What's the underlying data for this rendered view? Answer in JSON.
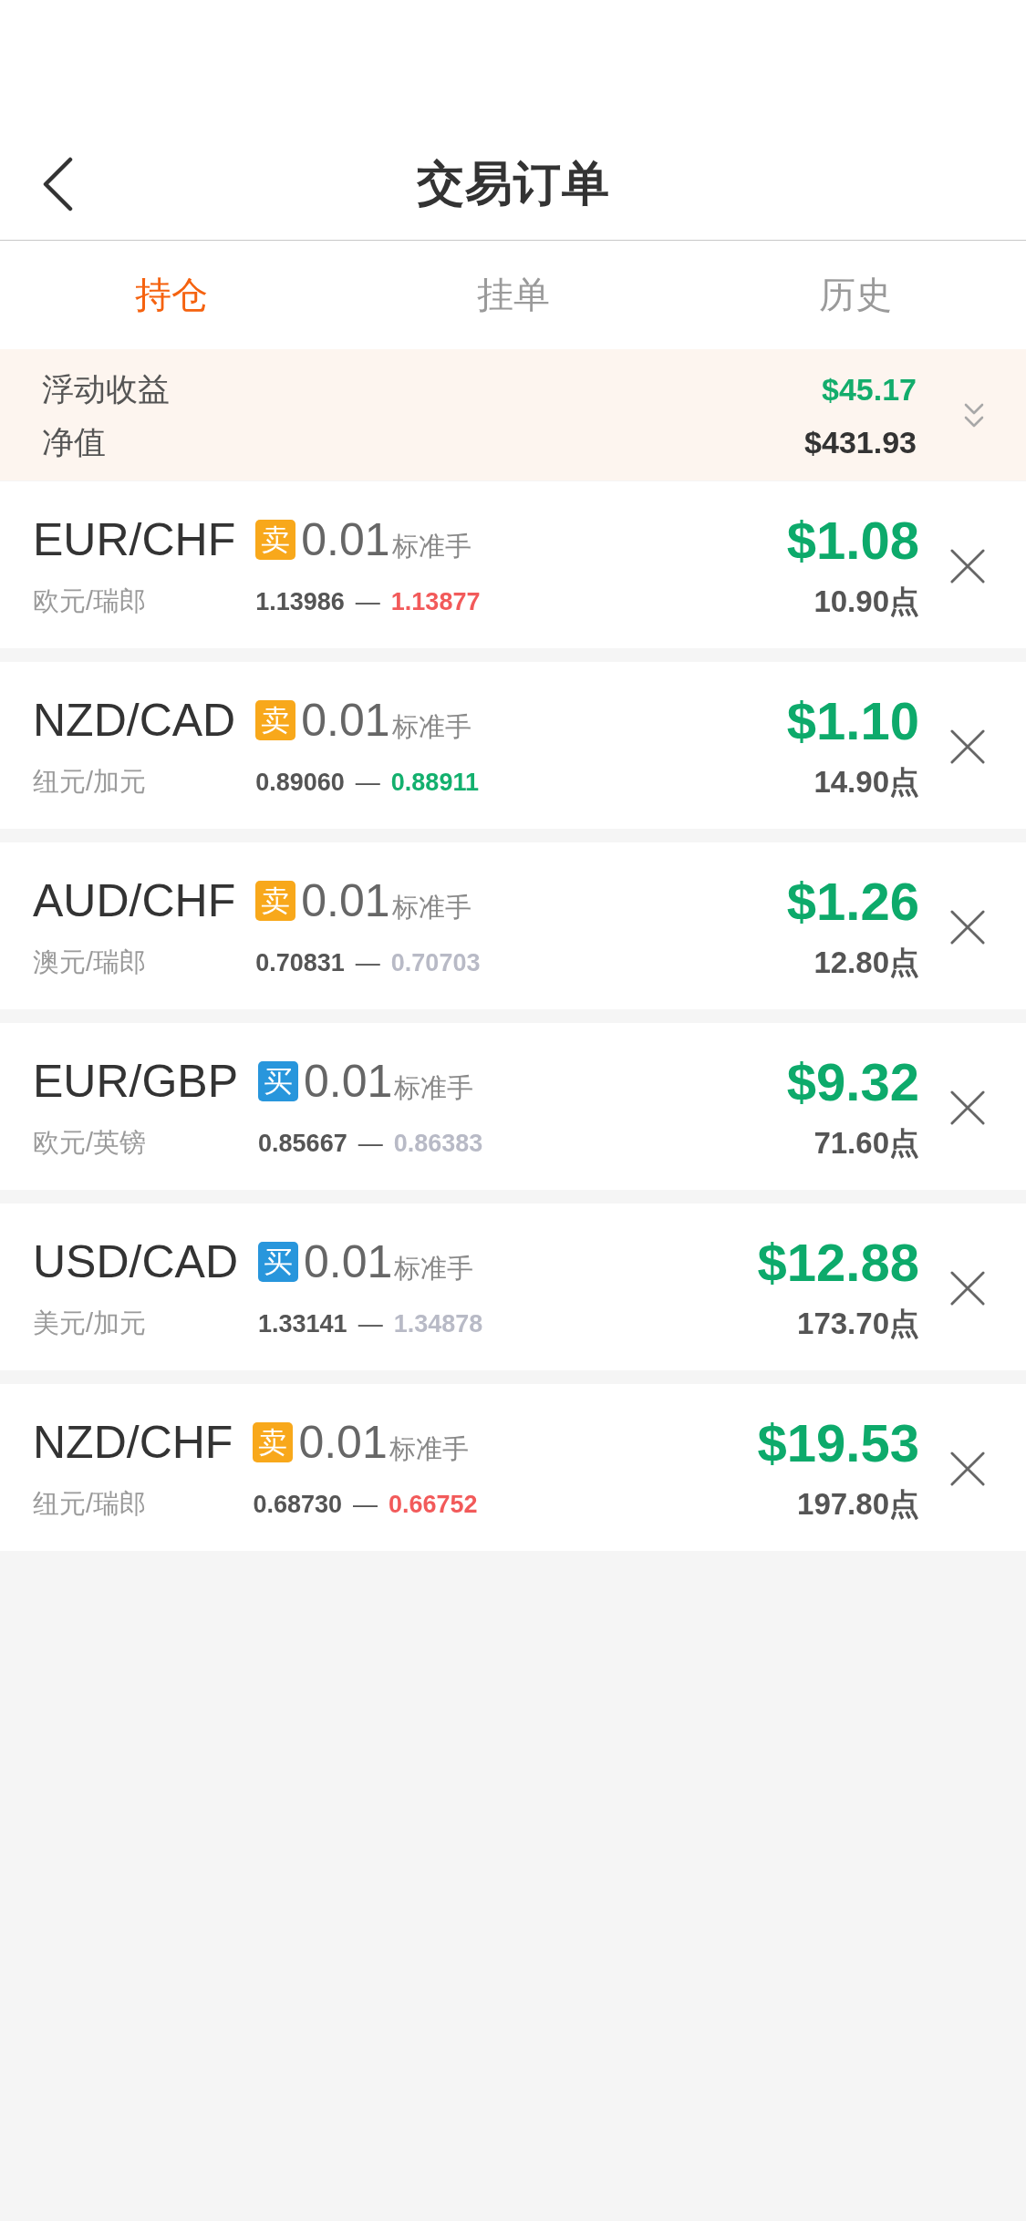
{
  "header": {
    "title": "交易订单"
  },
  "tabs": [
    {
      "label": "持仓",
      "selected": true
    },
    {
      "label": "挂单",
      "selected": false
    },
    {
      "label": "历史",
      "selected": false
    }
  ],
  "summary": {
    "floating_pnl": {
      "label": "浮动收益",
      "value": "$45.17"
    },
    "equity": {
      "label": "净值",
      "value": "$431.93"
    }
  },
  "positions": [
    {
      "symbol": "EUR/CHF",
      "name": "欧元/瑞郎",
      "side": {
        "kind": "sell",
        "label": "卖"
      },
      "lots": "0.01",
      "unit": "标准手",
      "open_price": "1.13986",
      "separator": "—",
      "current_price": {
        "text": "1.13877",
        "color": "#f25a5a"
      },
      "profit": "$1.08",
      "points": "10.90点"
    },
    {
      "symbol": "NZD/CAD",
      "name": "纽元/加元",
      "side": {
        "kind": "sell",
        "label": "卖"
      },
      "lots": "0.01",
      "unit": "标准手",
      "open_price": "0.89060",
      "separator": "—",
      "current_price": {
        "text": "0.88911",
        "color": "#13b06e"
      },
      "profit": "$1.10",
      "points": "14.90点"
    },
    {
      "symbol": "AUD/CHF",
      "name": "澳元/瑞郎",
      "side": {
        "kind": "sell",
        "label": "卖"
      },
      "lots": "0.01",
      "unit": "标准手",
      "open_price": "0.70831",
      "separator": "—",
      "current_price": {
        "text": "0.70703",
        "color": "#b8bac6"
      },
      "profit": "$1.26",
      "points": "12.80点"
    },
    {
      "symbol": "EUR/GBP",
      "name": "欧元/英镑",
      "side": {
        "kind": "buy",
        "label": "买"
      },
      "lots": "0.01",
      "unit": "标准手",
      "open_price": "0.85667",
      "separator": "—",
      "current_price": {
        "text": "0.86383",
        "color": "#b8bac6"
      },
      "profit": "$9.32",
      "points": "71.60点"
    },
    {
      "symbol": "USD/CAD",
      "name": "美元/加元",
      "side": {
        "kind": "buy",
        "label": "买"
      },
      "lots": "0.01",
      "unit": "标准手",
      "open_price": "1.33141",
      "separator": "—",
      "current_price": {
        "text": "1.34878",
        "color": "#b8bac6"
      },
      "profit": "$12.88",
      "points": "173.70点"
    },
    {
      "symbol": "NZD/CHF",
      "name": "纽元/瑞郎",
      "side": {
        "kind": "sell",
        "label": "卖"
      },
      "lots": "0.01",
      "unit": "标准手",
      "open_price": "0.68730",
      "separator": "—",
      "current_price": {
        "text": "0.66752",
        "color": "#f25a5a"
      },
      "profit": "$19.53",
      "points": "197.80点"
    }
  ]
}
